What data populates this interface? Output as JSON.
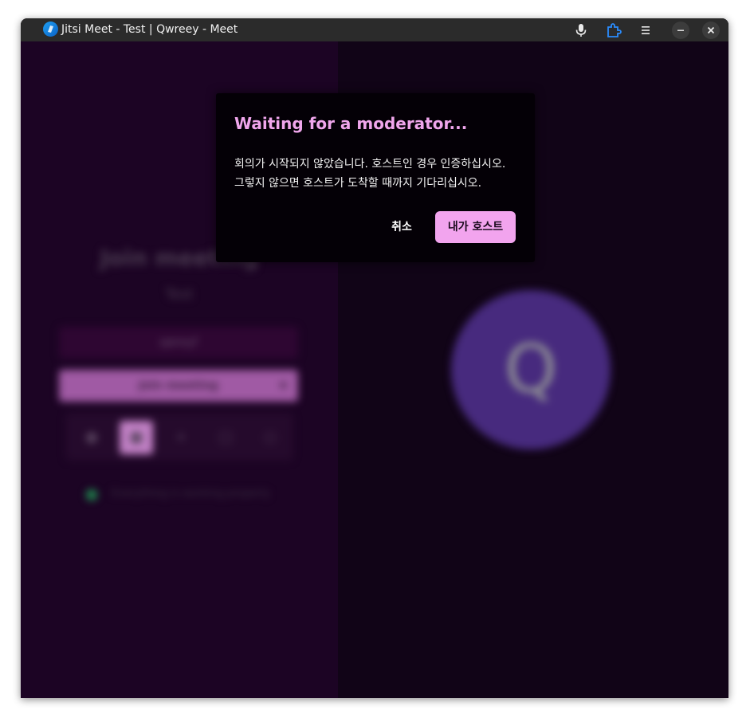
{
  "window": {
    "title": "Jitsi Meet - Test | Qwreey - Meet",
    "controls": {
      "mic_icon": "microphone-icon",
      "extension_icon": "puzzle-icon",
      "menu_icon": "hamburger-menu-icon",
      "minimize_icon": "minimize-icon",
      "close_icon": "close-icon"
    }
  },
  "prejoin": {
    "heading": "Join meeting",
    "room_name": "Test",
    "name_value": "qwreyf",
    "join_button_label": "Join meeting",
    "status_text": "Everything is working properly"
  },
  "participant": {
    "avatar_letter": "Q"
  },
  "dialog": {
    "title": "Waiting for a moderator...",
    "body": "회의가 시작되지 않았습니다. 호스트인 경우 인증하십시오. 그렇지 않으면 호스트가 도착할 때까지 기다리십시오.",
    "cancel_label": "취소",
    "host_label": "내가 호스트"
  },
  "colors": {
    "dialog_title": "#f0a6ec",
    "primary_button": "#f2a4ee",
    "avatar": "#472a7e",
    "window_bg": "#14051b"
  }
}
